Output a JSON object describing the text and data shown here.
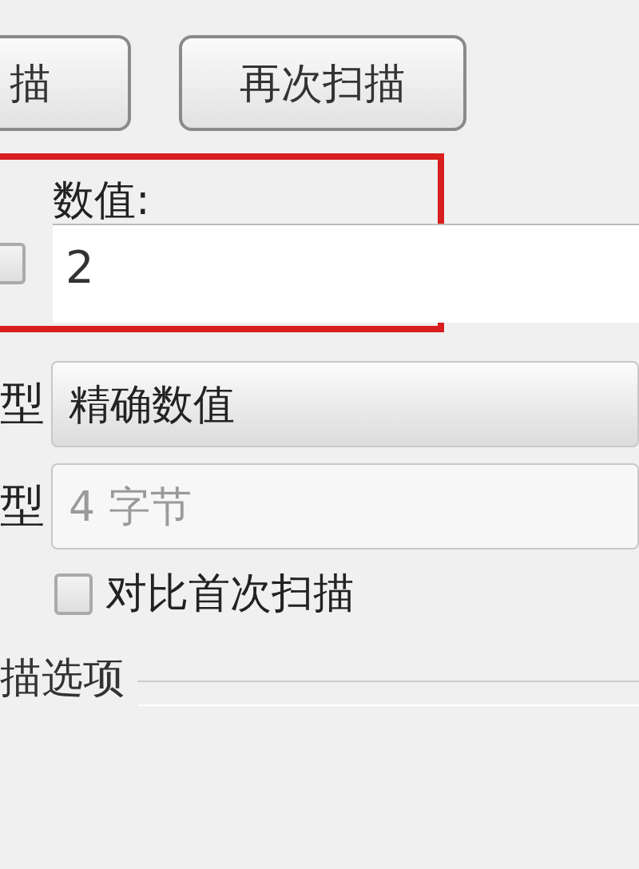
{
  "buttons": [
    {
      "label": "描"
    },
    {
      "label": "再次扫描"
    }
  ],
  "value_field": {
    "label": "数值:",
    "value": "2",
    "checkbox": {
      "checked": false
    },
    "highlighted": true
  },
  "scan_type": {
    "label": "型",
    "value": "精确数值"
  },
  "value_type": {
    "label": "型",
    "value": "4 字节",
    "disabled": true
  },
  "compare_first": {
    "label": "对比首次扫描",
    "checked": false
  },
  "scan_options": {
    "title": "描选项"
  }
}
